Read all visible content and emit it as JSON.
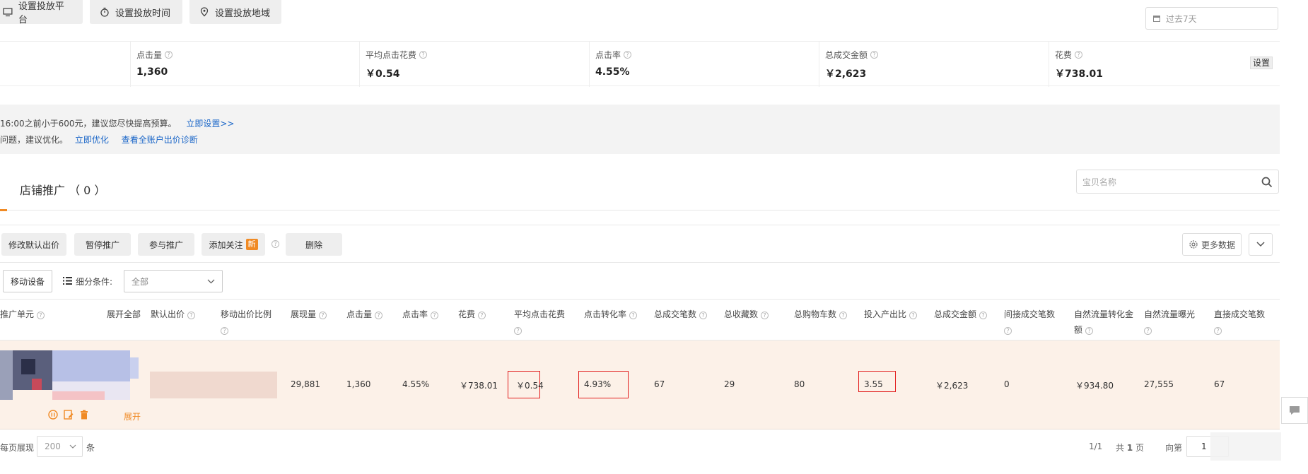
{
  "top_buttons": {
    "platform": "设置投放平台",
    "time": "设置投放时间",
    "region": "设置投放地域"
  },
  "date_range": {
    "placeholder": "过去7天"
  },
  "metrics": [
    {
      "label": "点击量",
      "value": "1,360"
    },
    {
      "label": "平均点击花费",
      "value": "￥0.54"
    },
    {
      "label": "点击率",
      "value": "4.55%"
    },
    {
      "label": "总成交金额",
      "value": "￥2,623"
    },
    {
      "label": "花费",
      "value": "￥738.01"
    }
  ],
  "settings_label": "设置",
  "notice": {
    "line1_text": "16:00之前小于600元，建议您尽快提高预算。",
    "line1_link": "立即设置>>",
    "line2_text": "问题，建议优化。",
    "line2_link1": "立即优化",
    "line2_link2": "查看全账户出价诊断"
  },
  "tab": {
    "label": "店铺推广 （ 0 ）"
  },
  "search": {
    "placeholder": "宝贝名称"
  },
  "toolbar": {
    "modify_bid": "修改默认出价",
    "pause": "暂停推广",
    "join": "参与推广",
    "add_follow": "添加关注",
    "new_badge": "新",
    "delete": "删除",
    "more_data": "更多数据"
  },
  "filter": {
    "device": "移动设备",
    "condition_label": "细分条件:",
    "condition_value": "全部"
  },
  "table": {
    "headers": {
      "unit": "推广单元",
      "expand_all": "展开全部",
      "default_bid": "默认出价",
      "mobile_ratio": "移动出价比例",
      "impressions": "展现量",
      "clicks": "点击量",
      "ctr": "点击率",
      "cost": "花费",
      "avg_cpc": "平均点击花费",
      "cvr": "点击转化率",
      "total_orders": "总成交笔数",
      "favorites": "总收藏数",
      "carts": "总购物车数",
      "roi": "投入产出比",
      "gmv": "总成交金额",
      "indirect_orders": "间接成交笔数",
      "organic_gmv": "自然流量转化金额",
      "organic_impr": "自然流量曝光",
      "direct_orders": "直接成交笔数"
    },
    "row": {
      "expand": "展开",
      "impressions": "29,881",
      "clicks": "1,360",
      "ctr": "4.55%",
      "cost": "￥738.01",
      "avg_cpc": "￥0.54",
      "cvr": "4.93%",
      "total_orders": "67",
      "favorites": "29",
      "carts": "80",
      "roi": "3.55",
      "gmv": "￥2,623",
      "indirect_orders": "0",
      "organic_gmv": "￥934.80",
      "organic_impr": "27,555",
      "direct_orders": "67"
    }
  },
  "pager": {
    "per_page_label": "每页展现",
    "per_page_value": "200",
    "unit": "条",
    "page_info": "1/1",
    "total_prefix": "共",
    "total_pages": "1",
    "total_suffix": "页",
    "goto_label": "向第",
    "goto_value": "1"
  },
  "colors": {
    "accent": "#f08a24",
    "link": "#1a66c8",
    "highlight_box": "#e21b1b",
    "row_bg": "#fcf1e8"
  }
}
